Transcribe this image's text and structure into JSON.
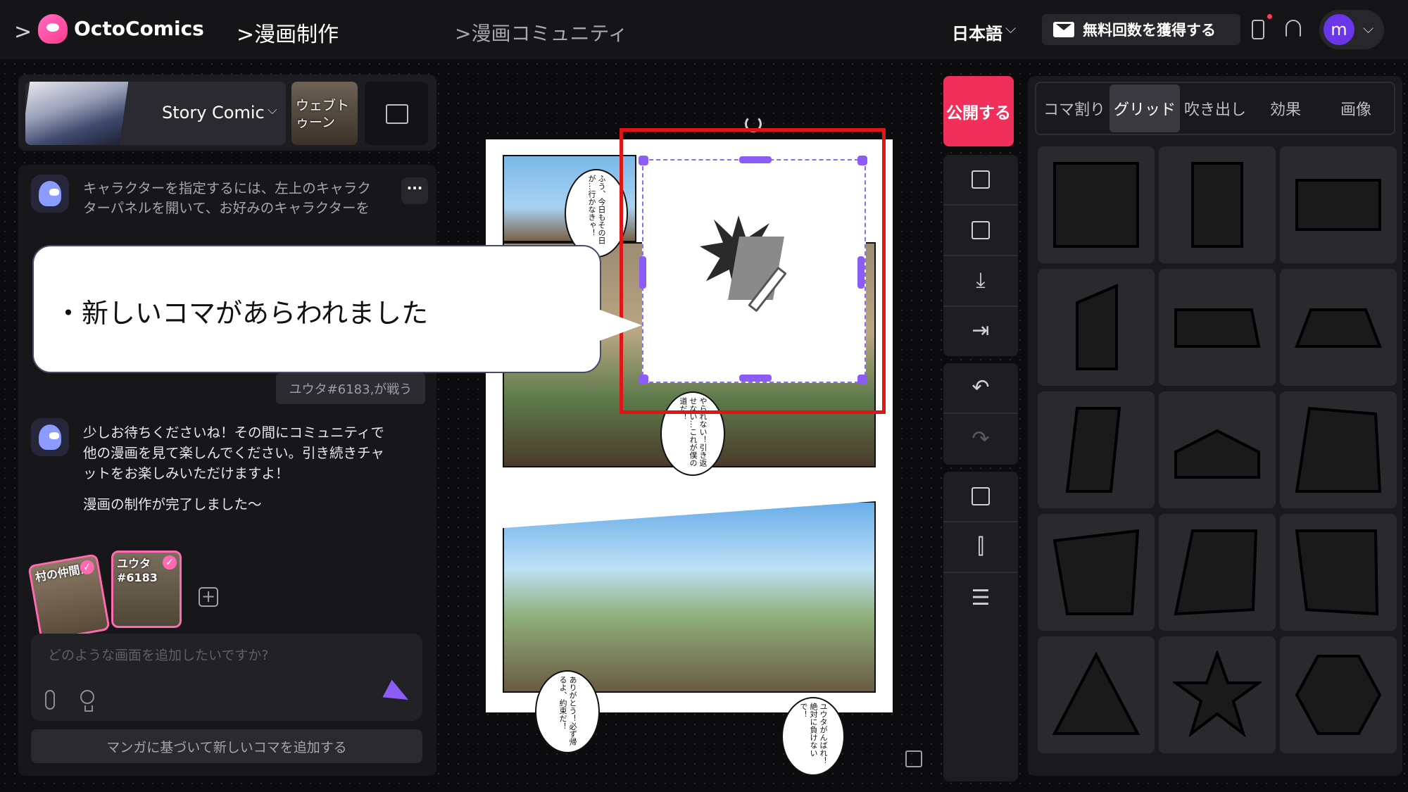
{
  "topbar": {
    "logo": "OctoComics",
    "breadcrumb_active": "漫画制作",
    "breadcrumb_inactive": "漫画コミュニティ",
    "language": "日本語",
    "promo_label": "無料回数を獲得する",
    "avatar_initial": "m"
  },
  "style": {
    "name": "Story Comic",
    "webtoon_label": "ウェブトゥーン"
  },
  "chat": {
    "bot_message_1": "キャラクターを指定するには、左上のキャラクターパネルを開いて、お好みのキャラクターを選ぶか、チャットボックスに想像するキャラク",
    "user_message": "ユウタ#6183,が戦う",
    "bot_message_2": "少しお待ちくださいね！その間にコミュニティで他の漫画を見て楽しんでください。引き続きチャットをお楽しみいただけますよ！",
    "bot_message_3": "漫画の制作が完了しました～",
    "characters": [
      {
        "label": "村の仲間た"
      },
      {
        "label": "ユウタ#6183"
      }
    ],
    "input_placeholder": "どのような画面を追加したいですか?",
    "add_panel_button": "マンガに基づいて新しいコマを追加する"
  },
  "callout": {
    "text": "・新しいコマがあらわれました"
  },
  "comic": {
    "speech_1": "ふう、今日もその日が…行かなきゃ！",
    "speech_2": "やられない！引き返せない…これが僕の道だ！",
    "speech_3": "ありがとう！必ず帰るよ、約束だ！",
    "speech_4": "ユウタがんばれ！絶対に負けないで！"
  },
  "toolbar": {
    "publish": "公開する"
  },
  "shape_panel": {
    "tabs": [
      "コマ割り",
      "グリッド",
      "吹き出し",
      "効果",
      "画像"
    ],
    "active_tab": "グリッド"
  }
}
